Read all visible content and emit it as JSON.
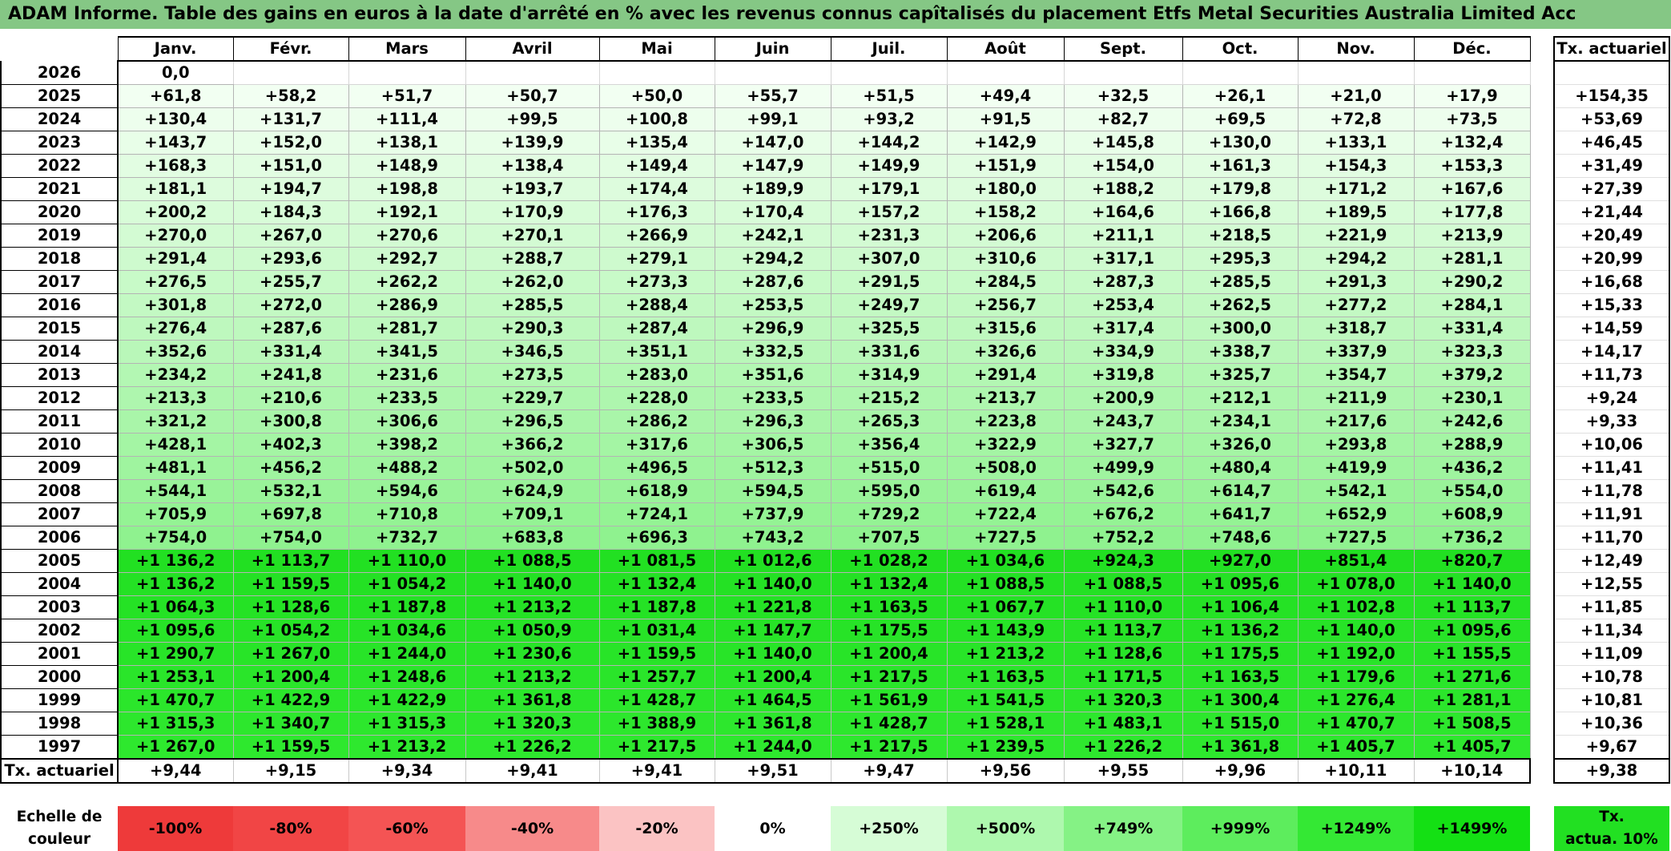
{
  "title": "ADAM Informe. Table des gains en euros à la date d'arrêté en % avec les revenus connus capîtalisés du placement Etfs Metal Securities Australia Limited Acc",
  "months": [
    "Janv.",
    "Févr.",
    "Mars",
    "Avril",
    "Mai",
    "Juin",
    "Juil.",
    "Août",
    "Sept.",
    "Oct.",
    "Nov.",
    "Déc."
  ],
  "rate_header": "Tx. actuariel",
  "rows": [
    {
      "year": "2026",
      "values": [
        "0,0",
        "",
        "",
        "",
        "",
        "",
        "",
        "",
        "",
        "",
        "",
        ""
      ],
      "rate": ""
    },
    {
      "year": "2025",
      "values": [
        "+61,8",
        "+58,2",
        "+51,7",
        "+50,7",
        "+50,0",
        "+55,7",
        "+51,5",
        "+49,4",
        "+32,5",
        "+26,1",
        "+21,0",
        "+17,9"
      ],
      "rate": "+154,35"
    },
    {
      "year": "2024",
      "values": [
        "+130,4",
        "+131,7",
        "+111,4",
        "+99,5",
        "+100,8",
        "+99,1",
        "+93,2",
        "+91,5",
        "+82,7",
        "+69,5",
        "+72,8",
        "+73,5"
      ],
      "rate": "+53,69"
    },
    {
      "year": "2023",
      "values": [
        "+143,7",
        "+152,0",
        "+138,1",
        "+139,9",
        "+135,4",
        "+147,0",
        "+144,2",
        "+142,9",
        "+145,8",
        "+130,0",
        "+133,1",
        "+132,4"
      ],
      "rate": "+46,45"
    },
    {
      "year": "2022",
      "values": [
        "+168,3",
        "+151,0",
        "+148,9",
        "+138,4",
        "+149,4",
        "+147,9",
        "+149,9",
        "+151,9",
        "+154,0",
        "+161,3",
        "+154,3",
        "+153,3"
      ],
      "rate": "+31,49"
    },
    {
      "year": "2021",
      "values": [
        "+181,1",
        "+194,7",
        "+198,8",
        "+193,7",
        "+174,4",
        "+189,9",
        "+179,1",
        "+180,0",
        "+188,2",
        "+179,8",
        "+171,2",
        "+167,6"
      ],
      "rate": "+27,39"
    },
    {
      "year": "2020",
      "values": [
        "+200,2",
        "+184,3",
        "+192,1",
        "+170,9",
        "+176,3",
        "+170,4",
        "+157,2",
        "+158,2",
        "+164,6",
        "+166,8",
        "+189,5",
        "+177,8"
      ],
      "rate": "+21,44"
    },
    {
      "year": "2019",
      "values": [
        "+270,0",
        "+267,0",
        "+270,6",
        "+270,1",
        "+266,9",
        "+242,1",
        "+231,3",
        "+206,6",
        "+211,1",
        "+218,5",
        "+221,9",
        "+213,9"
      ],
      "rate": "+20,49"
    },
    {
      "year": "2018",
      "values": [
        "+291,4",
        "+293,6",
        "+292,7",
        "+288,7",
        "+279,1",
        "+294,2",
        "+307,0",
        "+310,6",
        "+317,1",
        "+295,3",
        "+294,2",
        "+281,1"
      ],
      "rate": "+20,99"
    },
    {
      "year": "2017",
      "values": [
        "+276,5",
        "+255,7",
        "+262,2",
        "+262,0",
        "+273,3",
        "+287,6",
        "+291,5",
        "+284,5",
        "+287,3",
        "+285,5",
        "+291,3",
        "+290,2"
      ],
      "rate": "+16,68"
    },
    {
      "year": "2016",
      "values": [
        "+301,8",
        "+272,0",
        "+286,9",
        "+285,5",
        "+288,4",
        "+253,5",
        "+249,7",
        "+256,7",
        "+253,4",
        "+262,5",
        "+277,2",
        "+284,1"
      ],
      "rate": "+15,33"
    },
    {
      "year": "2015",
      "values": [
        "+276,4",
        "+287,6",
        "+281,7",
        "+290,3",
        "+287,4",
        "+296,9",
        "+325,5",
        "+315,6",
        "+317,4",
        "+300,0",
        "+318,7",
        "+331,4"
      ],
      "rate": "+14,59"
    },
    {
      "year": "2014",
      "values": [
        "+352,6",
        "+331,4",
        "+341,5",
        "+346,5",
        "+351,1",
        "+332,5",
        "+331,6",
        "+326,6",
        "+334,9",
        "+338,7",
        "+337,9",
        "+323,3"
      ],
      "rate": "+14,17"
    },
    {
      "year": "2013",
      "values": [
        "+234,2",
        "+241,8",
        "+231,6",
        "+273,5",
        "+283,0",
        "+351,6",
        "+314,9",
        "+291,4",
        "+319,8",
        "+325,7",
        "+354,7",
        "+379,2"
      ],
      "rate": "+11,73"
    },
    {
      "year": "2012",
      "values": [
        "+213,3",
        "+210,6",
        "+233,5",
        "+229,7",
        "+228,0",
        "+233,5",
        "+215,2",
        "+213,7",
        "+200,9",
        "+212,1",
        "+211,9",
        "+230,1"
      ],
      "rate": "+9,24"
    },
    {
      "year": "2011",
      "values": [
        "+321,2",
        "+300,8",
        "+306,6",
        "+296,5",
        "+286,2",
        "+296,3",
        "+265,3",
        "+223,8",
        "+243,7",
        "+234,1",
        "+217,6",
        "+242,6"
      ],
      "rate": "+9,33"
    },
    {
      "year": "2010",
      "values": [
        "+428,1",
        "+402,3",
        "+398,2",
        "+366,2",
        "+317,6",
        "+306,5",
        "+356,4",
        "+322,9",
        "+327,7",
        "+326,0",
        "+293,8",
        "+288,9"
      ],
      "rate": "+10,06"
    },
    {
      "year": "2009",
      "values": [
        "+481,1",
        "+456,2",
        "+488,2",
        "+502,0",
        "+496,5",
        "+512,3",
        "+515,0",
        "+508,0",
        "+499,9",
        "+480,4",
        "+419,9",
        "+436,2"
      ],
      "rate": "+11,41"
    },
    {
      "year": "2008",
      "values": [
        "+544,1",
        "+532,1",
        "+594,6",
        "+624,9",
        "+618,9",
        "+594,5",
        "+595,0",
        "+619,4",
        "+542,6",
        "+614,7",
        "+542,1",
        "+554,0"
      ],
      "rate": "+11,78"
    },
    {
      "year": "2007",
      "values": [
        "+705,9",
        "+697,8",
        "+710,8",
        "+709,1",
        "+724,1",
        "+737,9",
        "+729,2",
        "+722,4",
        "+676,2",
        "+641,7",
        "+652,9",
        "+608,9"
      ],
      "rate": "+11,91"
    },
    {
      "year": "2006",
      "values": [
        "+754,0",
        "+754,0",
        "+732,7",
        "+683,8",
        "+696,3",
        "+743,2",
        "+707,5",
        "+727,5",
        "+752,2",
        "+748,6",
        "+727,5",
        "+736,2"
      ],
      "rate": "+11,70"
    },
    {
      "year": "2005",
      "values": [
        "+1 136,2",
        "+1 113,7",
        "+1 110,0",
        "+1 088,5",
        "+1 081,5",
        "+1 012,6",
        "+1 028,2",
        "+1 034,6",
        "+924,3",
        "+927,0",
        "+851,4",
        "+820,7"
      ],
      "rate": "+12,49"
    },
    {
      "year": "2004",
      "values": [
        "+1 136,2",
        "+1 159,5",
        "+1 054,2",
        "+1 140,0",
        "+1 132,4",
        "+1 140,0",
        "+1 132,4",
        "+1 088,5",
        "+1 088,5",
        "+1 095,6",
        "+1 078,0",
        "+1 140,0"
      ],
      "rate": "+12,55"
    },
    {
      "year": "2003",
      "values": [
        "+1 064,3",
        "+1 128,6",
        "+1 187,8",
        "+1 213,2",
        "+1 187,8",
        "+1 221,8",
        "+1 163,5",
        "+1 067,7",
        "+1 110,0",
        "+1 106,4",
        "+1 102,8",
        "+1 113,7"
      ],
      "rate": "+11,85"
    },
    {
      "year": "2002",
      "values": [
        "+1 095,6",
        "+1 054,2",
        "+1 034,6",
        "+1 050,9",
        "+1 031,4",
        "+1 147,7",
        "+1 175,5",
        "+1 143,9",
        "+1 113,7",
        "+1 136,2",
        "+1 140,0",
        "+1 095,6"
      ],
      "rate": "+11,34"
    },
    {
      "year": "2001",
      "values": [
        "+1 290,7",
        "+1 267,0",
        "+1 244,0",
        "+1 230,6",
        "+1 159,5",
        "+1 140,0",
        "+1 200,4",
        "+1 213,2",
        "+1 128,6",
        "+1 175,5",
        "+1 192,0",
        "+1 155,5"
      ],
      "rate": "+11,09"
    },
    {
      "year": "2000",
      "values": [
        "+1 253,1",
        "+1 200,4",
        "+1 248,6",
        "+1 213,2",
        "+1 257,7",
        "+1 200,4",
        "+1 217,5",
        "+1 163,5",
        "+1 171,5",
        "+1 163,5",
        "+1 179,6",
        "+1 271,6"
      ],
      "rate": "+10,78"
    },
    {
      "year": "1999",
      "values": [
        "+1 470,7",
        "+1 422,9",
        "+1 422,9",
        "+1 361,8",
        "+1 428,7",
        "+1 464,5",
        "+1 561,9",
        "+1 541,5",
        "+1 320,3",
        "+1 300,4",
        "+1 276,4",
        "+1 281,1"
      ],
      "rate": "+10,81"
    },
    {
      "year": "1998",
      "values": [
        "+1 315,3",
        "+1 340,7",
        "+1 315,3",
        "+1 320,3",
        "+1 388,9",
        "+1 361,8",
        "+1 428,7",
        "+1 528,1",
        "+1 483,1",
        "+1 515,0",
        "+1 470,7",
        "+1 508,5"
      ],
      "rate": "+10,36"
    },
    {
      "year": "1997",
      "values": [
        "+1 267,0",
        "+1 159,5",
        "+1 213,2",
        "+1 226,2",
        "+1 217,5",
        "+1 244,0",
        "+1 217,5",
        "+1 239,5",
        "+1 226,2",
        "+1 361,8",
        "+1 405,7",
        "+1 405,7"
      ],
      "rate": "+9,67"
    }
  ],
  "tx_row": {
    "label": "Tx. actuariel",
    "values": [
      "+9,44",
      "+9,15",
      "+9,34",
      "+9,41",
      "+9,41",
      "+9,51",
      "+9,47",
      "+9,56",
      "+9,55",
      "+9,96",
      "+10,11",
      "+10,14"
    ],
    "total": "+9,38"
  },
  "scale": {
    "label_line1": "Echelle de",
    "label_line2": "couleur",
    "items": [
      {
        "text": "-100%",
        "color": "#ee3a3a",
        "align": "lft"
      },
      {
        "text": "-80%",
        "color": "#f14545",
        "align": "lft"
      },
      {
        "text": "-60%",
        "color": "#f45454",
        "align": "lft"
      },
      {
        "text": "-40%",
        "color": "#f78a8a",
        "align": "lft"
      },
      {
        "text": "-20%",
        "color": "#fbc3c3",
        "align": "lft"
      },
      {
        "text": "0%",
        "color": "#ffffff",
        "align": "mid"
      },
      {
        "text": "+250%",
        "color": "#d6fcd6",
        "align": "rgt"
      },
      {
        "text": "+500%",
        "color": "#aef8ae",
        "align": "rgt"
      },
      {
        "text": "+749%",
        "color": "#85f285",
        "align": "rgt"
      },
      {
        "text": "+999%",
        "color": "#5ded5d",
        "align": "rgt"
      },
      {
        "text": "+1249%",
        "color": "#34e834",
        "align": "rgt"
      },
      {
        "text": "+1499%",
        "color": "#14e014",
        "align": "rgt"
      }
    ],
    "rate_line1": "Tx.",
    "rate_line2": "actua. 10%",
    "rate_color": "#22e022"
  },
  "colors": {
    "title_bg": "#85c785",
    "row_tint_start": "#f4fff4",
    "row_tint_2005": "#22e022"
  }
}
